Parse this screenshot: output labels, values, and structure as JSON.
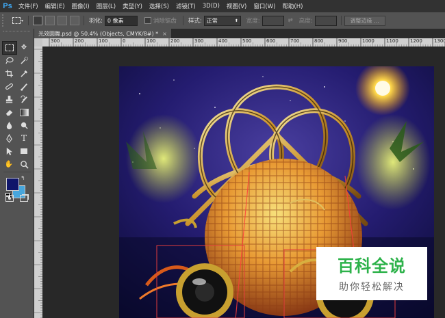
{
  "app": {
    "logo": "Ps"
  },
  "menu": [
    "文件(F)",
    "编辑(E)",
    "图像(I)",
    "图层(L)",
    "类型(Y)",
    "选择(S)",
    "滤镜(T)",
    "3D(D)",
    "视图(V)",
    "窗口(W)",
    "帮助(H)"
  ],
  "options": {
    "feather_label": "羽化:",
    "feather_value": "0 像素",
    "antialias_label": "消除锯齿",
    "style_label": "样式:",
    "style_value": "正常",
    "width_label": "宽度:",
    "height_label": "高度:",
    "refine_edge_button": "调整边缘 ..."
  },
  "document": {
    "tab_title": "光效圆舞.psd @ 50.4% (Objects, CMYK/8#) *",
    "close": "×"
  },
  "ruler": {
    "h_ticks": [
      "300",
      "200",
      "100",
      "0",
      "100",
      "200",
      "300",
      "400",
      "500",
      "600",
      "700",
      "800",
      "900",
      "1000",
      "1100",
      "1200",
      "1300"
    ],
    "v_ticks": []
  },
  "watermark": {
    "title": "百科全说",
    "subtitle": "助你轻松解决"
  },
  "colors": {
    "foreground": "#10166a",
    "background": "#47a6dc",
    "accent": "#2db24a"
  }
}
